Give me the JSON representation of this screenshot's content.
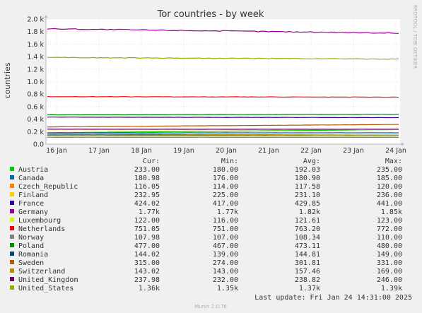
{
  "title": "Tor countries - by week",
  "ylabel": "countries",
  "side_text": "RRDTOOL / TOBI OETIKER",
  "footer": "Munin 2.0.76",
  "last_update": "Last update: Fri Jan 24 14:31:00 2025",
  "legend_headers": [
    "Cur:",
    "Min:",
    "Avg:",
    "Max:"
  ],
  "chart_data": {
    "type": "line",
    "title": "Tor countries - by week",
    "ylabel": "countries",
    "xlabel": "",
    "ylim": [
      0,
      2000
    ],
    "grid": true,
    "x_ticks": [
      "16 Jan",
      "17 Jan",
      "18 Jan",
      "19 Jan",
      "20 Jan",
      "21 Jan",
      "22 Jan",
      "23 Jan",
      "24 Jan"
    ],
    "y_ticks": [
      {
        "v": 0,
        "label": "0.0"
      },
      {
        "v": 200,
        "label": "0.2 k"
      },
      {
        "v": 400,
        "label": "0.4 k"
      },
      {
        "v": 600,
        "label": "0.6 k"
      },
      {
        "v": 800,
        "label": "0.8 k"
      },
      {
        "v": 1000,
        "label": "1.0 k"
      },
      {
        "v": 1200,
        "label": "1.2 k"
      },
      {
        "v": 1400,
        "label": "1.4 k"
      },
      {
        "v": 1600,
        "label": "1.6 k"
      },
      {
        "v": 1800,
        "label": "1.8 k"
      },
      {
        "v": 2000,
        "label": "2.0 k"
      }
    ],
    "series": [
      {
        "name": "Austria",
        "color": "#00cc00",
        "cur": "233.00",
        "min": "180.00",
        "avg": "192.03",
        "max": "235.00",
        "v0": 182,
        "v1": 233
      },
      {
        "name": "Canada",
        "color": "#0066b3",
        "cur": "180.98",
        "min": "176.00",
        "avg": "180.90",
        "max": "185.00",
        "v0": 181,
        "v1": 181
      },
      {
        "name": "Czech_Republic",
        "color": "#ff8000",
        "cur": "116.05",
        "min": "114.00",
        "avg": "117.58",
        "max": "120.00",
        "v0": 118,
        "v1": 116
      },
      {
        "name": "Finland",
        "color": "#ffcc00",
        "cur": "232.95",
        "min": "225.00",
        "avg": "231.10",
        "max": "236.00",
        "v0": 230,
        "v1": 233
      },
      {
        "name": "France",
        "color": "#330099",
        "cur": "424.02",
        "min": "417.00",
        "avg": "429.85",
        "max": "441.00",
        "v0": 432,
        "v1": 424
      },
      {
        "name": "Germany",
        "color": "#990099",
        "cur": "1.77k",
        "min": "1.77k",
        "avg": "1.82k",
        "max": "1.85k",
        "v0": 1845,
        "v1": 1775
      },
      {
        "name": "Luxembourg",
        "color": "#ccff00",
        "cur": "122.00",
        "min": "116.00",
        "avg": "121.61",
        "max": "123.00",
        "v0": 121,
        "v1": 122
      },
      {
        "name": "Netherlands",
        "color": "#ff0000",
        "cur": "751.05",
        "min": "751.00",
        "avg": "763.20",
        "max": "772.00",
        "v0": 760,
        "v1": 751
      },
      {
        "name": "Norway",
        "color": "#808080",
        "cur": "107.98",
        "min": "107.00",
        "avg": "108.34",
        "max": "110.00",
        "v0": 109,
        "v1": 108
      },
      {
        "name": "Poland",
        "color": "#008f00",
        "cur": "477.00",
        "min": "467.00",
        "avg": "473.11",
        "max": "480.00",
        "v0": 469,
        "v1": 477
      },
      {
        "name": "Romania",
        "color": "#00487d",
        "cur": "144.02",
        "min": "139.00",
        "avg": "144.81",
        "max": "149.00",
        "v0": 146,
        "v1": 144
      },
      {
        "name": "Sweden",
        "color": "#b35a00",
        "cur": "315.00",
        "min": "274.00",
        "avg": "301.81",
        "max": "331.00",
        "v0": 276,
        "v1": 315
      },
      {
        "name": "Switzerland",
        "color": "#b38f00",
        "cur": "143.02",
        "min": "143.00",
        "avg": "157.46",
        "max": "169.00",
        "v0": 165,
        "v1": 143
      },
      {
        "name": "United_Kingdom",
        "color": "#6b006b",
        "cur": "237.98",
        "min": "232.00",
        "avg": "238.82",
        "max": "246.00",
        "v0": 240,
        "v1": 238
      },
      {
        "name": "United_States",
        "color": "#8fb300",
        "cur": "1.36k",
        "min": "1.35k",
        "avg": "1.37k",
        "max": "1.39k",
        "v0": 1385,
        "v1": 1360
      }
    ]
  }
}
